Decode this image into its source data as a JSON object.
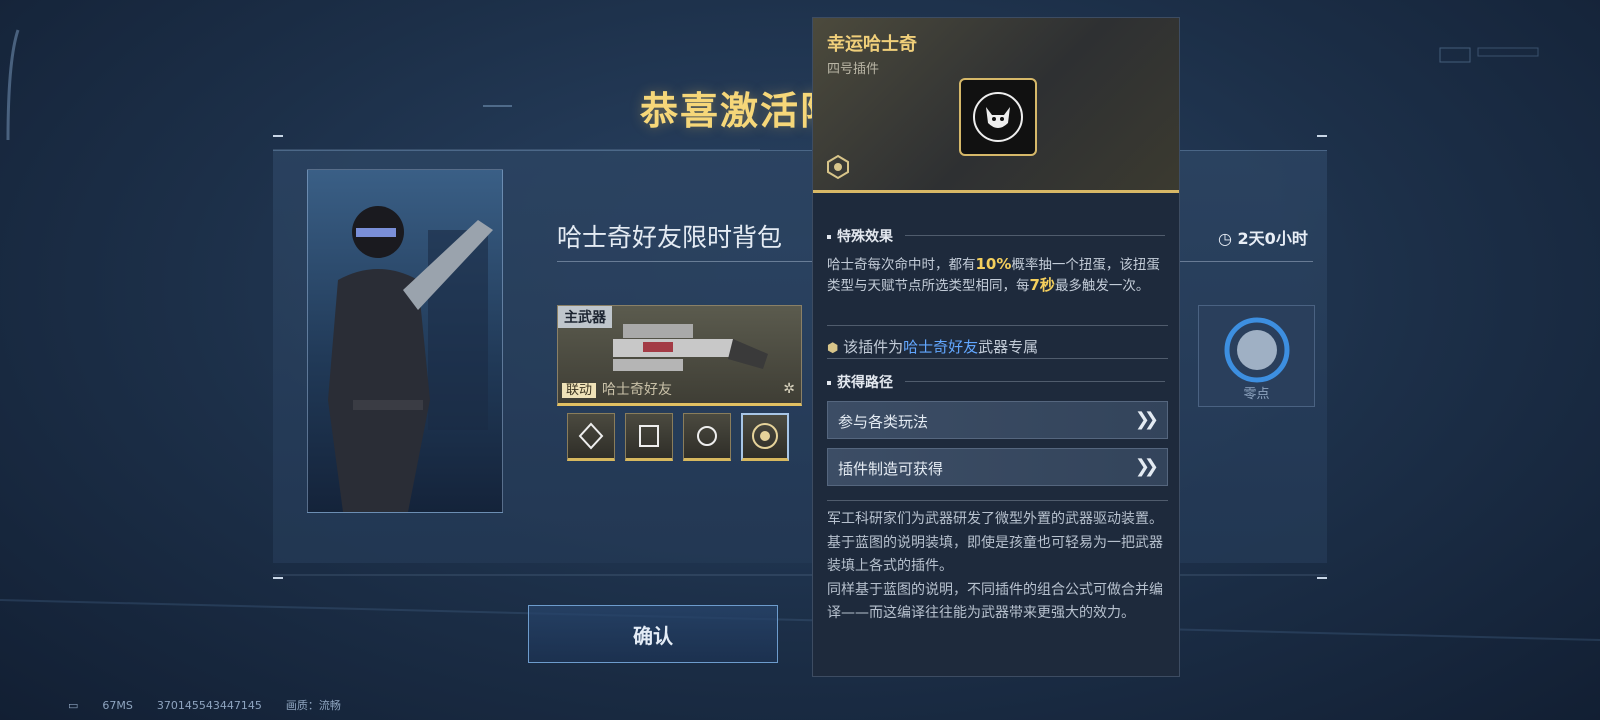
{
  "banner": {
    "title": "恭喜激活限时背包"
  },
  "pack": {
    "name": "哈士奇好友限时背包",
    "timer": "2天0小时",
    "weapon_tag": "主武器",
    "link_tag": "联动",
    "weapon_name": "哈士奇好友",
    "right_card_label": "零点"
  },
  "confirm": {
    "label": "确认"
  },
  "footer": {
    "ping": "67MS",
    "uid": "370145543447145",
    "quality": "画质：流畅"
  },
  "tooltip": {
    "name": "幸运哈士奇",
    "type": "四号插件",
    "effect_title": "特殊效果",
    "effect_pre": "哈士奇每次命中时，都有",
    "effect_pct": "10%",
    "effect_mid": "概率抽一个扭蛋，该扭蛋类型与天赋节点所选类型相同，每",
    "effect_sec": "7秒",
    "effect_post": "最多触发一次。",
    "exclusive_pre": "该插件为",
    "exclusive_weapon": "哈士奇好友",
    "exclusive_post": "武器专属",
    "route_title": "获得路径",
    "routes": [
      "参与各类玩法",
      "插件制造可获得"
    ],
    "desc": [
      "军工科研家们为武器研发了微型外置的武器驱动装置。",
      "基于蓝图的说明装填，即使是孩童也可轻易为一把武器装填上各式的插件。",
      "同样基于蓝图的说明，不同插件的组合公式可做合并编译——而这编译往往能为武器带来更强大的效力。"
    ]
  },
  "colors": {
    "gold": "#f6d779",
    "accent_blue": "#62a7ff",
    "highlight": "#f4cf5d"
  }
}
